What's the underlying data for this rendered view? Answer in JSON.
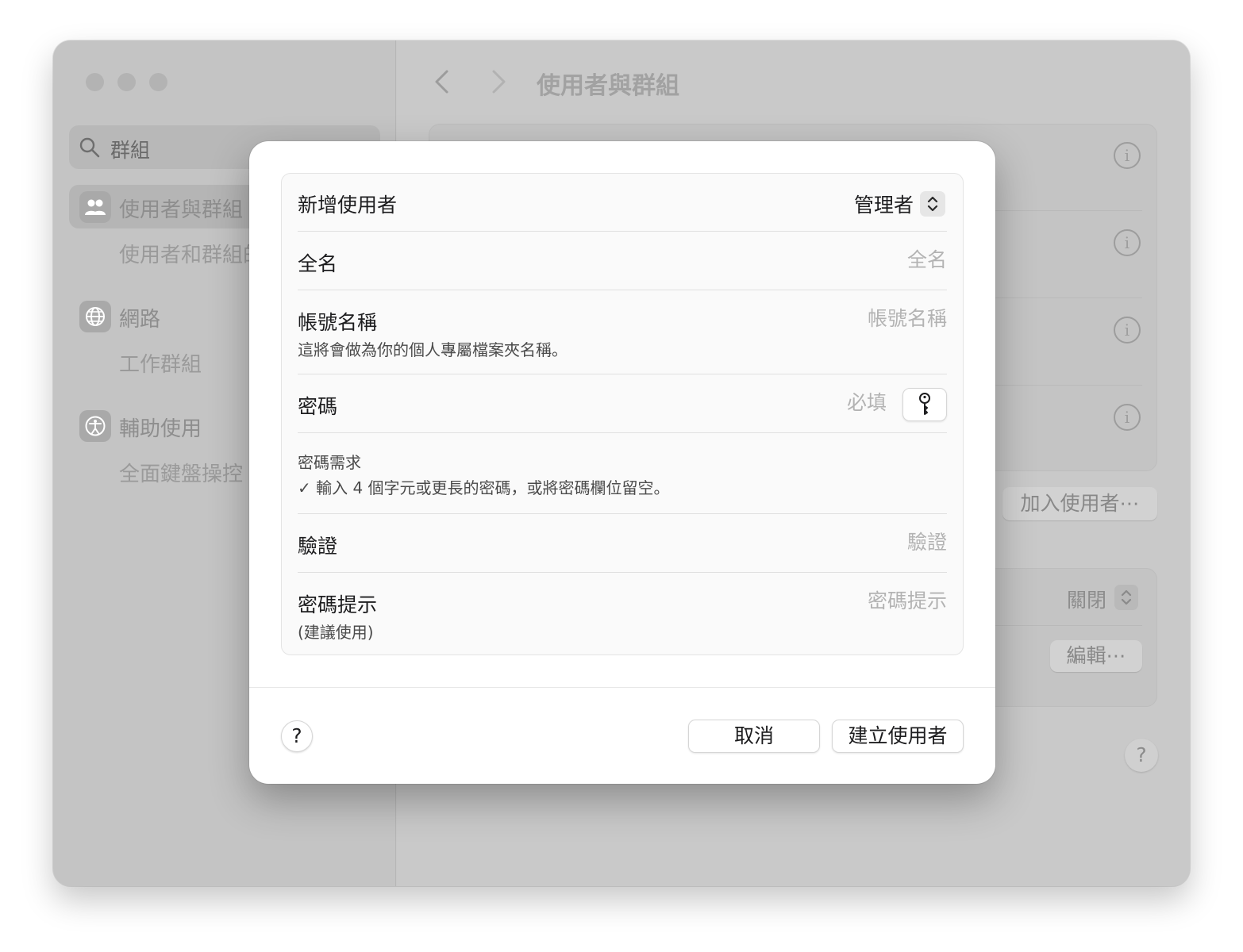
{
  "window": {
    "title": "使用者與群組"
  },
  "search": {
    "value": "群組"
  },
  "sidebar": {
    "items": [
      {
        "label": "使用者與群組",
        "icon": "users-icon",
        "selected": true
      },
      {
        "label": "使用者和群組的",
        "sub": true
      },
      {
        "label": "網路",
        "icon": "globe-icon"
      },
      {
        "label": "工作群組",
        "sub": true
      },
      {
        "label": "輔助使用",
        "icon": "accessibility-icon"
      },
      {
        "label": "全面鍵盤操控",
        "sub": true
      }
    ]
  },
  "content": {
    "add_user_label": "加入使用者⋯",
    "off_value": "關閉",
    "edit_label": "編輯⋯",
    "help": "?"
  },
  "dialog": {
    "new_user_label": "新增使用者",
    "role_value": "管理者",
    "fields": {
      "full_name": {
        "label": "全名",
        "placeholder": "全名"
      },
      "account_name": {
        "label": "帳號名稱",
        "placeholder": "帳號名稱",
        "note": "這將會做為你的個人專屬檔案夾名稱。"
      },
      "password": {
        "label": "密碼",
        "placeholder": "必填"
      },
      "verify": {
        "label": "驗證",
        "placeholder": "驗證"
      },
      "hint": {
        "label": "密碼提示",
        "note": "(建議使用)",
        "placeholder": "密碼提示"
      }
    },
    "requirements": {
      "title": "密碼需求",
      "item": "✓ 輸入 4 個字元或更長的密碼，或將密碼欄位留空。"
    },
    "help": "?",
    "cancel_label": "取消",
    "create_label": "建立使用者"
  },
  "colors": {
    "dim_overlay": "#c7c7c7",
    "dialog_bg": "#ffffff"
  }
}
